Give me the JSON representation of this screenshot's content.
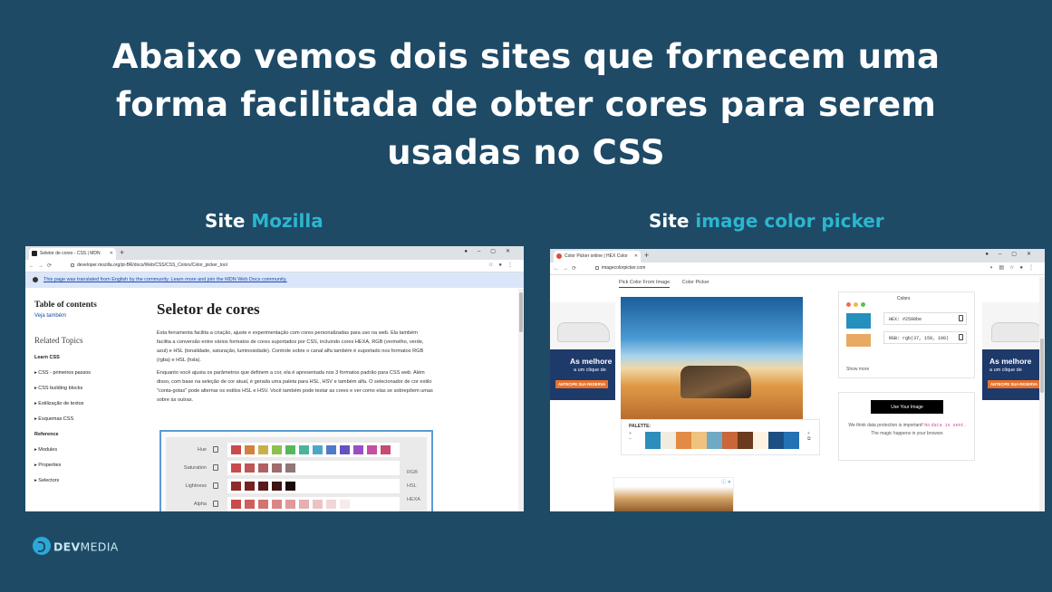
{
  "headline": "Abaixo vemos dois sites que fornecem uma forma facilitada de obter cores para serem usadas no CSS",
  "captions": {
    "left_prefix": "Site ",
    "left_highlight": "Mozilla",
    "right_prefix": "Site ",
    "right_highlight": "image color picker"
  },
  "colors": {
    "background": "#1e4a66",
    "highlight": "#2bb6cf"
  },
  "mdn": {
    "tab_title": "Seletor de cores - CSS | MDN",
    "url": "developer.mozilla.org/pt-BR/docs/Web/CSS/CSS_Colors/Color_picker_tool",
    "banner": "This page was translated from English by the community. Learn more and join the MDN Web Docs community.",
    "toc_title": "Table of contents",
    "toc_link": "Veja também",
    "related_title": "Related Topics",
    "side_items": [
      {
        "label": "Learn CSS",
        "bold": true
      },
      {
        "label": "▸ CSS - primeiros passos",
        "bold": false
      },
      {
        "label": "▸ CSS building blocks",
        "bold": false
      },
      {
        "label": "▸ Estilização de textos",
        "bold": false
      },
      {
        "label": "▸ Esquemas CSS",
        "bold": false
      },
      {
        "label": "Reference",
        "bold": true
      },
      {
        "label": "▸ Modules",
        "bold": false
      },
      {
        "label": "▸ Properties",
        "bold": false
      },
      {
        "label": "▸ Selectors",
        "bold": false
      }
    ],
    "heading": "Seletor de cores",
    "para1": "Esta ferramenta facilita a criação, ajuste e experimentação com cores personalizadas para uso na web. Ela também facilita a conversão entre vários formatos de cores suportados por CSS, incluindo cores HEXA, RGB (vermelho, verde, azul) e HSL (tonalidade, saturação, luminosidade). Controle sobre o canal alfa também é suportado nos formatos RGB (rgba) e HSL (hsla).",
    "para2": "Enquanto você ajusta os parâmetros que definem a cor, ela é apresentada nos 3 formatos padrão para CSS web. Além disso, com base na seleção de cor atual, é gerada uma paleta para HSL, HSV e também alfa. O selecionador de cor estilo \"conta-gotas\" pode alternar os estilos HSL e HSV. Você também pode testar as cores e ver como elas se sobrepõem umas sobre às outras.",
    "picker_rows": [
      {
        "label": "Hue",
        "swatches": [
          "#c94b4b",
          "#d2813f",
          "#c9b04a",
          "#8fbf4f",
          "#56b75b",
          "#4bb39a",
          "#4aa8c7",
          "#4f7bc9",
          "#6452c4",
          "#9b4ec2",
          "#c44fa4",
          "#c74c72"
        ]
      },
      {
        "label": "Saturation",
        "swatches": [
          "#c94b4b",
          "#bd5656",
          "#b06262",
          "#a06c6c",
          "#917777"
        ]
      },
      {
        "label": "Lightness",
        "swatches": [
          "#8e2a2a",
          "#742222",
          "#5a1a1a",
          "#3f1212",
          "#1e0808"
        ]
      },
      {
        "label": "Alpha",
        "swatches": [
          "#c94b4b",
          "#cf5e5e",
          "#d57272",
          "#db8686",
          "#e09a9a",
          "#e6aeae",
          "#ecc2c2",
          "#f2d6d6",
          "#f8eaea"
        ]
      }
    ],
    "picker_tags": [
      "RGB",
      "HSL",
      "HEXA"
    ]
  },
  "icp": {
    "tab_title": "Color Picker online | HEX Color",
    "url": "imagecolorpicker.com",
    "tabs": [
      "Pick Color From Image",
      "Color Picker"
    ],
    "palette_title": "PALETTE:",
    "palette": [
      "#2d8dbd",
      "#f1ecdf",
      "#e38b44",
      "#efc27f",
      "#6fa9c5",
      "#c9663a",
      "#6b3a1f",
      "#fdf2e1",
      "#1b4f84",
      "#2571b5"
    ],
    "colors_title": "Colors",
    "swatch_main": "#2590be",
    "swatch_second": "#e8a962",
    "hex_value": "HEX: #2590be",
    "rgb_value": "RGB: rgb(37, 150, 190)",
    "show_more": "Show more",
    "use_button": "Use Your Image",
    "note_before": "We think data protection is important!",
    "note_hl_1": "No",
    "note_hl_2": "data is sent.",
    "note_after": "The magic happens in your browser.",
    "ad_title": "As melhore",
    "ad_sub": "a um clique de",
    "ad_cta": "ANTECIPE SUA RESERVA",
    "ad_x": "ⓘ ✕"
  },
  "brand": {
    "bold": "DEV",
    "light": "MEDIA"
  }
}
